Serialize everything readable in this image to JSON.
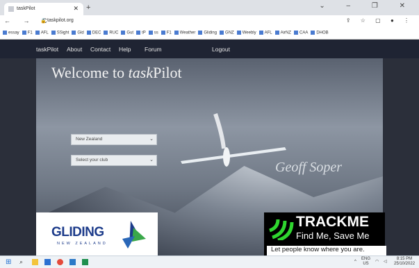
{
  "browser": {
    "tab_title": "taskPilot",
    "new_tab": "+",
    "window_controls": "⌄ – ❐ ✕",
    "nav_glyphs": "← → C",
    "url": "taskpilot.org",
    "right_icons": "⇪ ☆ ▢ ● ⋮",
    "bookmarks": [
      "essay",
      "F1",
      "AFL",
      "SSight",
      "Gld",
      "DEC",
      "RUC",
      "Gut",
      "tP",
      "ss",
      "F1",
      "Weather",
      "Gliding",
      "GNZ",
      "Weebly",
      "AFL",
      "AirNZ",
      "CAA",
      "DHOB"
    ]
  },
  "site_nav": {
    "brand": "taskPilot",
    "about": "About",
    "contact": "Contact",
    "help": "Help",
    "forum": "Forum",
    "logout": "Logout"
  },
  "hero": {
    "title_prefix": "Welcome to ",
    "title_italic": "task",
    "title_suffix": "Pilot",
    "country_select": "New Zealand",
    "club_select": "Select your club",
    "signature": "Geoff Soper"
  },
  "logos": {
    "gliding_main": "GLIDING",
    "gliding_sub": "NEW ZEALAND",
    "trackme_main": "TRACKME",
    "trackme_tag": "Find Me, Save Me",
    "trackme_sub": "Let people know where you are."
  },
  "taskbar": {
    "lang": "ENG",
    "region": "US",
    "time": "8:15 PM",
    "date": "25/10/2022"
  },
  "colors": {
    "nav_bg": "#1f2433",
    "page_bg": "#2b2f3a",
    "track_green": "#2fd62f"
  }
}
